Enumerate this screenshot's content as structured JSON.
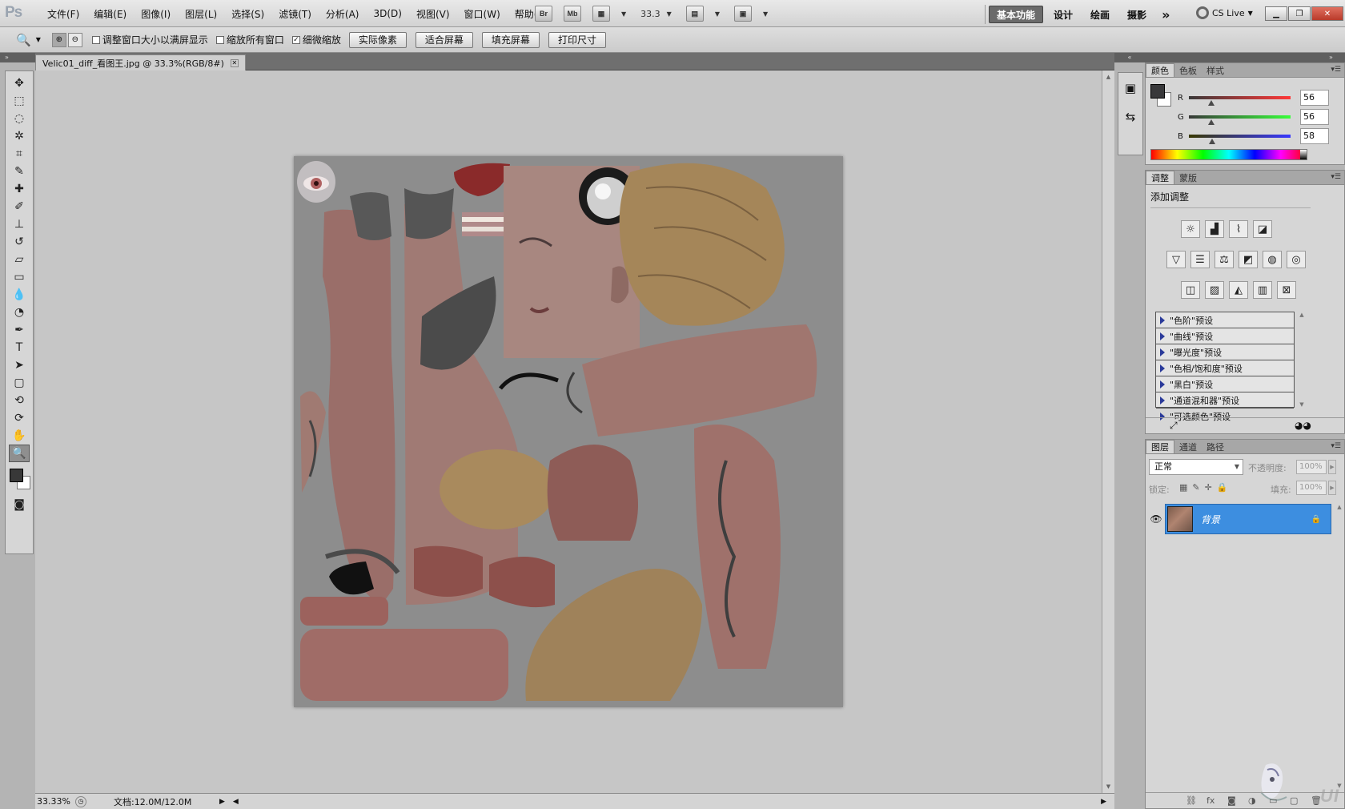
{
  "app": {
    "logo": "Ps",
    "menus": [
      "文件(F)",
      "编辑(E)",
      "图像(I)",
      "图层(L)",
      "选择(S)",
      "滤镜(T)",
      "分析(A)",
      "3D(D)",
      "视图(V)",
      "窗口(W)",
      "帮助(H)"
    ],
    "bridge_label": "Br",
    "minibridge_label": "Mb",
    "zoom_value": "33.3",
    "workspaces": [
      "基本功能",
      "设计",
      "绘画",
      "摄影"
    ],
    "workspace_more": "»",
    "cslive_label": "CS Live",
    "accent_color": "#3d8ee0"
  },
  "options": {
    "checkboxes": [
      {
        "label": "调整窗口大小以满屏显示",
        "checked": false
      },
      {
        "label": "缩放所有窗口",
        "checked": false
      },
      {
        "label": "细微缩放",
        "checked": true
      }
    ],
    "buttons": [
      "实际像素",
      "适合屏幕",
      "填充屏幕",
      "打印尺寸"
    ]
  },
  "document": {
    "tab_title": "Velic01_diff_看图王.jpg @ 33.3%(RGB/8#)",
    "status_zoom": "33.33%",
    "status_doc": "文档:12.0M/12.0M"
  },
  "tools": [
    "move-tool",
    "marquee-tool",
    "lasso-tool",
    "quick-select-tool",
    "crop-tool",
    "eyedropper-tool",
    "healing-tool",
    "brush-tool",
    "stamp-tool",
    "history-brush-tool",
    "eraser-tool",
    "gradient-tool",
    "blur-tool",
    "dodge-tool",
    "pen-tool",
    "type-tool",
    "path-select-tool",
    "shape-tool",
    "3d-rotate-tool",
    "3d-orbit-tool",
    "hand-tool",
    "zoom-tool"
  ],
  "color_panel": {
    "tabs": [
      "颜色",
      "色板",
      "样式"
    ],
    "channels": [
      {
        "label": "R",
        "value": "56",
        "fraction": 0.22,
        "gradient": "linear-gradient(to right,#383838,#ff3838)"
      },
      {
        "label": "G",
        "value": "56",
        "fraction": 0.22,
        "gradient": "linear-gradient(to right,#383838,#38ff3a)"
      },
      {
        "label": "B",
        "value": "58",
        "fraction": 0.23,
        "gradient": "linear-gradient(to right,#383800,#3838ff)"
      }
    ]
  },
  "adjust_panel": {
    "tabs": [
      "调整",
      "蒙版"
    ],
    "title": "添加调整",
    "presets": [
      "\"色阶\"预设",
      "\"曲线\"预设",
      "\"曝光度\"预设",
      "\"色相/饱和度\"预设",
      "\"黑白\"预设",
      "\"通道混和器\"预设",
      "\"可选颜色\"预设"
    ]
  },
  "layers_panel": {
    "tabs": [
      "图层",
      "通道",
      "路径"
    ],
    "blend_mode": "正常",
    "opacity_label": "不透明度:",
    "opacity_value": "100%",
    "lock_label": "锁定:",
    "fill_label": "填充:",
    "fill_value": "100%",
    "layer_name": "背景",
    "watermark": "UI"
  }
}
